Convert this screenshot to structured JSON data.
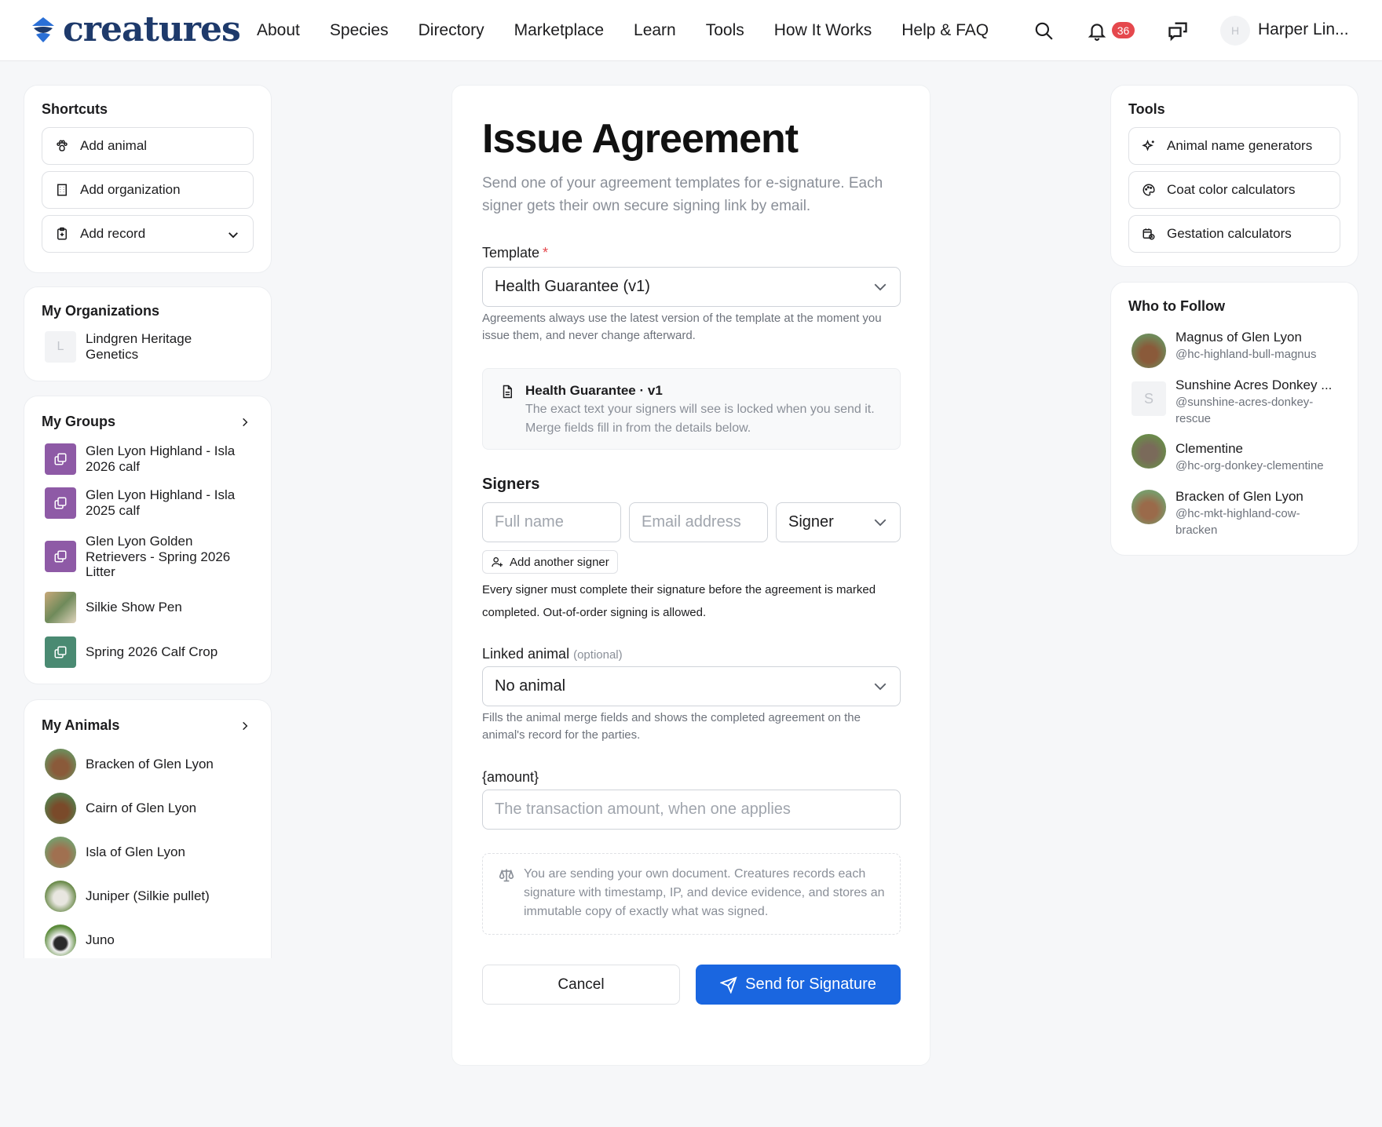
{
  "brand": {
    "name": "creatures",
    "color": "#1e3a6b"
  },
  "nav": [
    "About",
    "Species",
    "Directory",
    "Marketplace",
    "Learn",
    "Tools",
    "How It Works",
    "Help & FAQ"
  ],
  "header": {
    "notification_count": "36",
    "user_initial": "H",
    "user_name": "Harper Lin..."
  },
  "shortcuts": {
    "title": "Shortcuts",
    "items": [
      "Add animal",
      "Add organization",
      "Add record"
    ]
  },
  "organizations": {
    "title": "My Organizations",
    "items": [
      {
        "initial": "L",
        "name": "Lindgren Heritage Genetics"
      }
    ]
  },
  "groups": {
    "title": "My Groups",
    "items": [
      {
        "name": "Glen Lyon Highland - Isla 2026 calf"
      },
      {
        "name": "Glen Lyon Highland - Isla 2025 calf"
      },
      {
        "name": "Glen Lyon Golden Retrievers - Spring 2026 Litter"
      },
      {
        "name": "Silkie Show Pen"
      },
      {
        "name": "Spring 2026 Calf Crop"
      }
    ]
  },
  "animals": {
    "title": "My Animals",
    "items": [
      "Bracken of Glen Lyon",
      "Cairn of Glen Lyon",
      "Isla of Glen Lyon",
      "Juniper (Silkie pullet)",
      "Juno"
    ]
  },
  "form": {
    "title": "Issue Agreement",
    "subtitle": "Send one of your agreement templates for e-signature. Each signer gets their own secure signing link by email.",
    "template_label": "Template",
    "required_mark": "*",
    "template_value": "Health Guarantee (v1)",
    "template_help": "Agreements always use the latest version of the template at the moment you issue them, and never change afterward.",
    "info_title": "Health Guarantee · v1",
    "info_text": "The exact text your signers will see is locked when you send it. Merge fields fill in from the details below.",
    "signers_title": "Signers",
    "fullname_placeholder": "Full name",
    "email_placeholder": "Email address",
    "role_value": "Signer",
    "add_signer": "Add another signer",
    "signers_note": "Every signer must complete their signature before the agreement is marked completed. Out-of-order signing is allowed.",
    "linked_label": "Linked animal",
    "linked_optional": "(optional)",
    "linked_value": "No animal",
    "linked_help": "Fills the animal merge fields and shows the completed agreement on the animal's record for the parties.",
    "amount_label": "{amount}",
    "amount_placeholder": "The transaction amount, when one applies",
    "legal_text": "You are sending your own document. Creatures records each signature with timestamp, IP, and device evidence, and stores an immutable copy of exactly what was signed.",
    "cancel": "Cancel",
    "send": "Send for Signature",
    "accent": "#1a66e0"
  },
  "tools": {
    "title": "Tools",
    "items": [
      "Animal name generators",
      "Coat color calculators",
      "Gestation calculators"
    ]
  },
  "follow": {
    "title": "Who to Follow",
    "items": [
      {
        "name": "Magnus of Glen Lyon",
        "handle": "@hc-highland-bull-magnus"
      },
      {
        "name": "Sunshine Acres Donkey ...",
        "handle": "@sunshine-acres-donkey-rescue",
        "initial": "S"
      },
      {
        "name": "Clementine",
        "handle": "@hc-org-donkey-clementine"
      },
      {
        "name": "Bracken of Glen Lyon",
        "handle": "@hc-mkt-highland-cow-bracken"
      }
    ]
  }
}
